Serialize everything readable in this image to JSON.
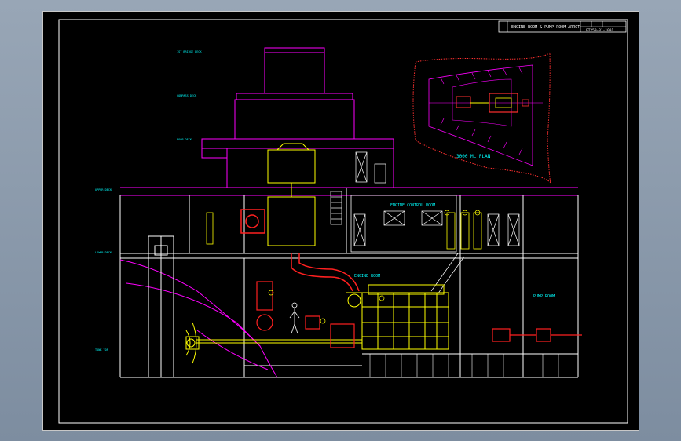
{
  "title_block": {
    "title": "ENGINE ROOM & PUMP ROOM ARRGT",
    "drawing_no": "FT250-31-1001"
  },
  "views": {
    "plan_caption": "3000 ML PLAN"
  },
  "compartments": {
    "engine_control_room": "ENGINE CONTROL ROOM",
    "engine_room": "ENGINE ROOM",
    "pump_room": "PUMP ROOM"
  },
  "deck_labels": {
    "top": "1ST BRIDGE DECK",
    "compass": "COMPASS DECK",
    "poop": "POOP DECK",
    "upper": "UPPER DECK",
    "lower": "LOWER DECK",
    "tank_top": "TANK TOP"
  },
  "colors": {
    "background": "#000000",
    "hull": "#ff00ff",
    "structure": "#ffffff",
    "engine": "#ffff00",
    "pump": "#ff2020",
    "text": "#00ffff"
  }
}
